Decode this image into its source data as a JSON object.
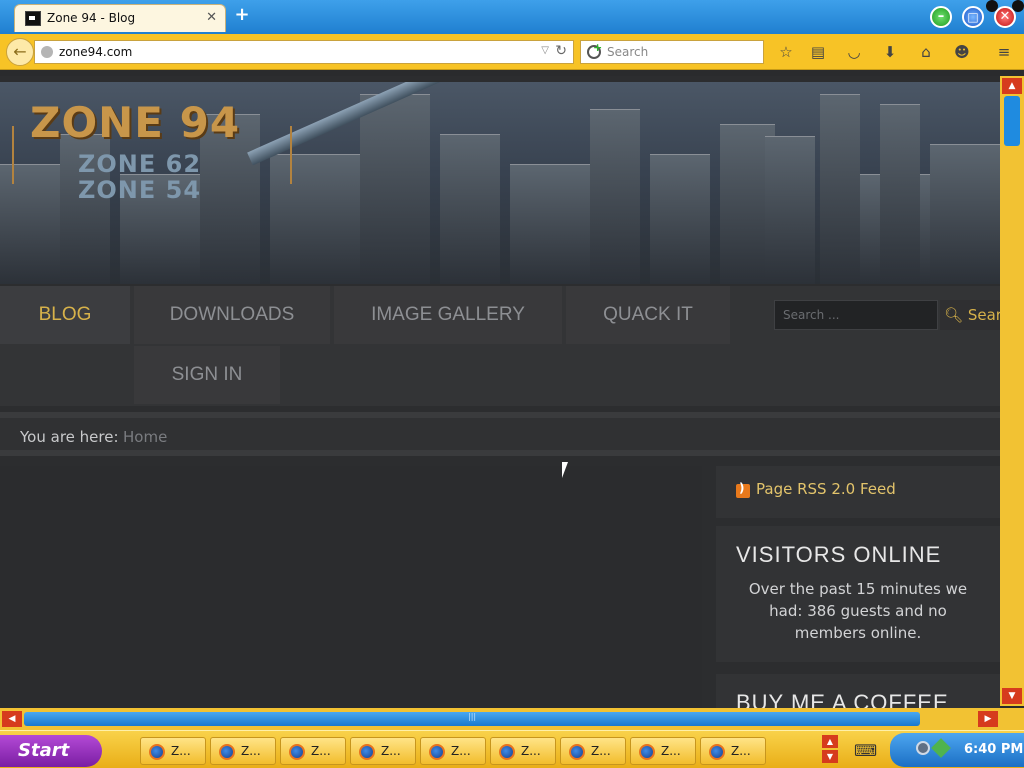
{
  "browser": {
    "tab_title": "Zone 94 - Blog",
    "tab_close": "✕",
    "new_tab": "+",
    "url": "zone94.com",
    "search_placeholder": "Search"
  },
  "site": {
    "logo_main": "ZONE 94",
    "logo_sub1": "ZONE 62",
    "logo_sub2": "ZONE 54",
    "menu": [
      {
        "label": "BLOG",
        "active": true
      },
      {
        "label": "DOWNLOADS"
      },
      {
        "label": "IMAGE GALLERY"
      },
      {
        "label": "QUACK IT"
      },
      {
        "label": "SIGN IN"
      }
    ],
    "search_placeholder": "Search ...",
    "search_button": "Search",
    "breadcrumb_label": "You are here:",
    "breadcrumb_home": "Home",
    "rss_link": "Page RSS 2.0 Feed",
    "visitors_title": "VISITORS ONLINE",
    "visitors_text": "Over the past 15 minutes we had: 386 guests and no members online.",
    "coffee_title": "BUY ME A COFFEE"
  },
  "taskbar": {
    "start_label": "Start",
    "task_label": "Z...",
    "clock": "6:40 PM"
  },
  "colors": {
    "accent": "#d7b24a",
    "page_bg": "#2c2d2f",
    "chrome": "#f7c326"
  }
}
